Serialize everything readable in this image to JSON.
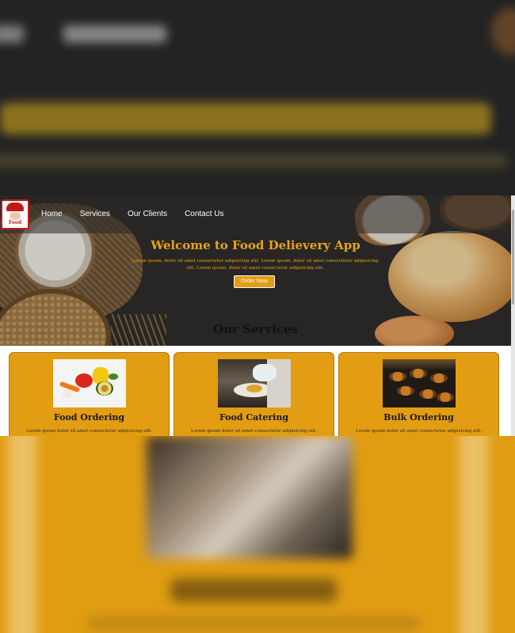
{
  "nav": {
    "logo_text": "Food",
    "items": [
      "Home",
      "Services",
      "Our Clients",
      "Contact Us"
    ]
  },
  "hero": {
    "title": "Welcome to Food Delievery App",
    "subtitle": "Lorem ipsum, dolor sit amet consectetur adipisicing elit. Lorem ipsum, dolor sit amet consectetur adipisicing elit. Lorem ipsum, dolor sit amet consectetur adipisicing elit.",
    "button": "Order Now"
  },
  "services": {
    "title": "Our Services",
    "cards": [
      {
        "title": "Food Ordering",
        "text": "Lorem ipsum dolor sit amet consectetur adipisicing elit.",
        "image": "vegetables"
      },
      {
        "title": "Food Catering",
        "text": "Lorem ipsum dolor sit amet consectetur adipisicing elit.",
        "image": "chef-plating"
      },
      {
        "title": "Bulk Ordering",
        "text": "Lorem ipsum dolor sit amet consectetur adipisicing elit.",
        "image": "catering-pots"
      }
    ]
  },
  "colors": {
    "accent": "#e39d12",
    "hero_text": "#e6a418",
    "logo_red": "#c41818"
  }
}
